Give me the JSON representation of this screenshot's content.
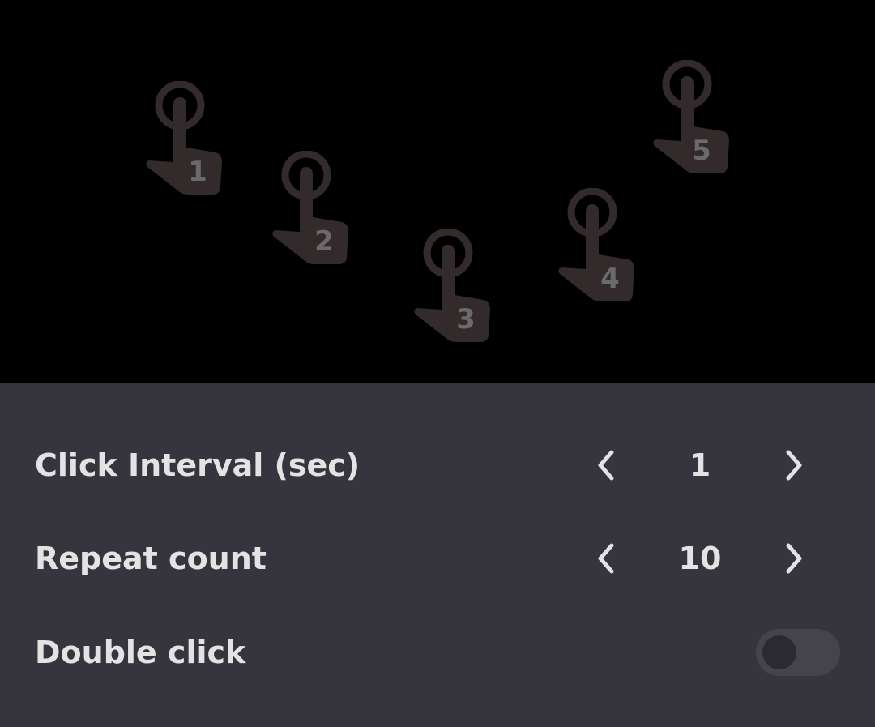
{
  "tap_points": [
    {
      "label": "1"
    },
    {
      "label": "2"
    },
    {
      "label": "3"
    },
    {
      "label": "4"
    },
    {
      "label": "5"
    }
  ],
  "settings": {
    "click_interval": {
      "label": "Click Interval (sec)",
      "value": "1"
    },
    "repeat_count": {
      "label": "Repeat count",
      "value": "10"
    },
    "double_click": {
      "label": "Double click",
      "enabled": false
    }
  },
  "icons": {
    "tap_point": "tap-hand-icon",
    "decrement": "chevron-left-icon",
    "increment": "chevron-right-icon"
  },
  "colors": {
    "canvas_background": "#000000",
    "panel_background": "#36353d",
    "hand_fill": "#332b2b",
    "label_text": "#e3e3e3",
    "tap_number_text": "#6a6a6a",
    "toggle_track": "#45444c",
    "toggle_knob": "#2b2a31"
  }
}
